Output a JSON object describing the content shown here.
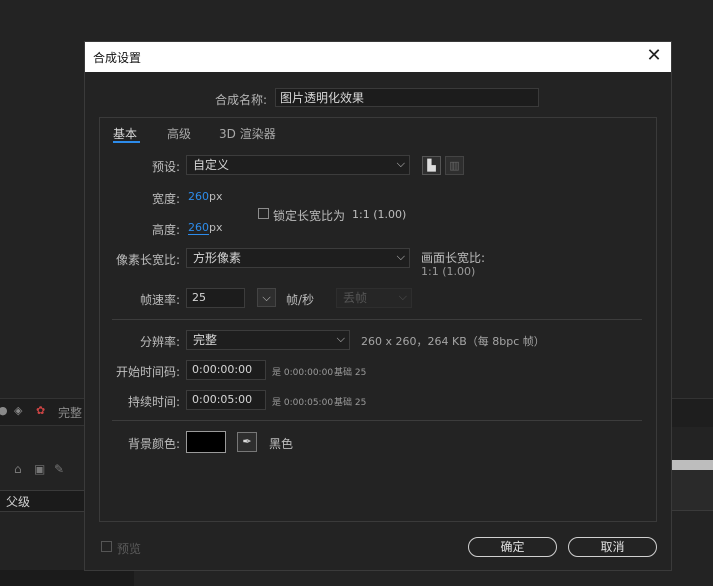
{
  "background": {
    "panel_label": "完整",
    "parent_header": "父级"
  },
  "dialog": {
    "title": "合成设置",
    "close_glyph": "✕",
    "comp_name_label": "合成名称:",
    "comp_name_value": "图片透明化效果",
    "tabs": [
      "基本",
      "高级",
      "3D 渲染器"
    ],
    "preset": {
      "label": "预设:",
      "value": "自定义"
    },
    "width": {
      "label": "宽度:",
      "value": "260",
      "unit": "px"
    },
    "height": {
      "label": "高度:",
      "value": "260",
      "unit": "px"
    },
    "lock_aspect": {
      "label": "锁定长宽比为",
      "ratio": "1:1 (1.00)",
      "checked": false
    },
    "pixel_aspect": {
      "label": "像素长宽比:",
      "value": "方形像素"
    },
    "frame_aspect": {
      "label": "画面长宽比:",
      "value": "1:1 (1.00)"
    },
    "frame_rate": {
      "label": "帧速率:",
      "value": "25",
      "unit": "帧/秒",
      "drop_frame": "丢帧"
    },
    "resolution": {
      "label": "分辨率:",
      "value": "完整",
      "info": "260 x 260，264 KB（每 8bpc 帧）"
    },
    "start_timecode": {
      "label": "开始时间码:",
      "value": "0:00:00:00",
      "info": "是 0:00:00:00",
      "base": "基础 25"
    },
    "duration": {
      "label": "持续时间:",
      "value": "0:00:05:00",
      "info": "是 0:00:05:00",
      "base": "基础 25"
    },
    "bg_color": {
      "label": "背景颜色:",
      "color": "#000000",
      "name": "黑色"
    },
    "preview_label": "预览",
    "ok_label": "确定",
    "cancel_label": "取消"
  },
  "colors": {
    "accent": "#2d8ceb",
    "dialog_bg": "#232323",
    "titlebar_bg": "#ffffff"
  }
}
